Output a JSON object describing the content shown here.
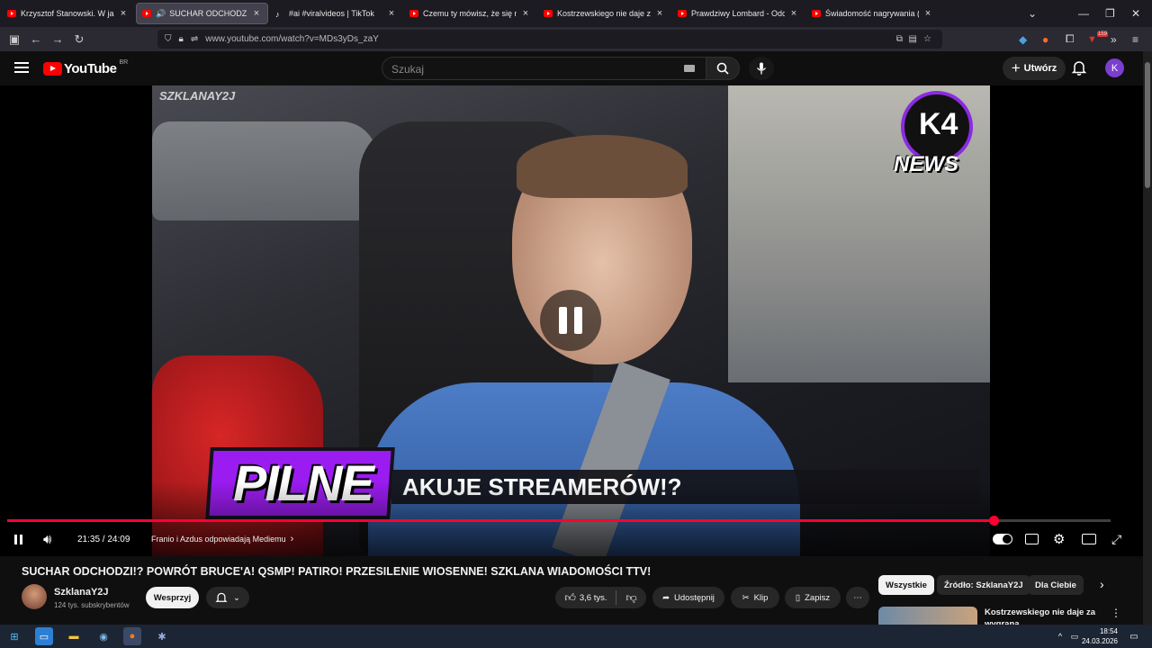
{
  "browser": {
    "tabs": [
      {
        "title": "Krzysztof Stanowski. W jakiej sp",
        "active": false,
        "icon": "youtube"
      },
      {
        "title": "SUCHAR ODCHODZI!? POW",
        "active": true,
        "icon": "youtube",
        "audio": "🔊"
      },
      {
        "title": "#ai #viralvideos | TikTok",
        "active": false,
        "icon": "tiktok"
      },
      {
        "title": "Czemu ty mówisz, że się na cieb",
        "active": false,
        "icon": "youtube"
      },
      {
        "title": "Kostrzewskiego nie daje za wyg",
        "active": false,
        "icon": "youtube"
      },
      {
        "title": "Prawdziwy Lombard - Odcinek",
        "active": false,
        "icon": "youtube"
      },
      {
        "title": "Świadomość nagrywania (Giełd",
        "active": false,
        "icon": "youtube"
      }
    ],
    "url": "www.youtube.com/watch?v=MDs3yDs_zaY",
    "extensions_badge": "159"
  },
  "youtube": {
    "logo": "YouTube",
    "country": "BR",
    "search_placeholder": "Szukaj",
    "create_label": "Utwórz",
    "avatar_letter": "K"
  },
  "video": {
    "watermark": "SZKLANAY2J",
    "k4_letter": "K4",
    "news_label": "NEWS",
    "banner_tag": "PILNE",
    "banner_text": "AKUJE STREAMERÓW!?",
    "time_current": "21:35",
    "time_sep": " / ",
    "time_total": "24:09",
    "chapter": "Franio i Azdus odpowiadają Mediemu",
    "progress_fraction": 0.8937
  },
  "info": {
    "title": "SUCHAR ODCHODZI!? POWRÓT BRUCE'A! QSMP! PATIRO! PRZESILENIE WIOSENNE! SZKLANA WIADOMOŚCI TTV!",
    "channel": "SzklanaY2J",
    "subscribers": "124 tys. subskrybentów",
    "support_label": "Wesprzyj",
    "likes": "3,6 tys.",
    "share_label": "Udostępnij",
    "clip_label": "Klip",
    "save_label": "Zapisz"
  },
  "sidebar": {
    "chips": [
      "Wszystkie",
      "Źródło: SzklanaY2J",
      "Dla Ciebie"
    ],
    "rec_title": "Kostrzewskiego nie daje za wygraną"
  },
  "taskbar": {
    "time": "18:54",
    "date": "24.03.2026"
  },
  "colors": {
    "accent_red": "#ff0033",
    "brand_purple": "#9b1cf0"
  }
}
